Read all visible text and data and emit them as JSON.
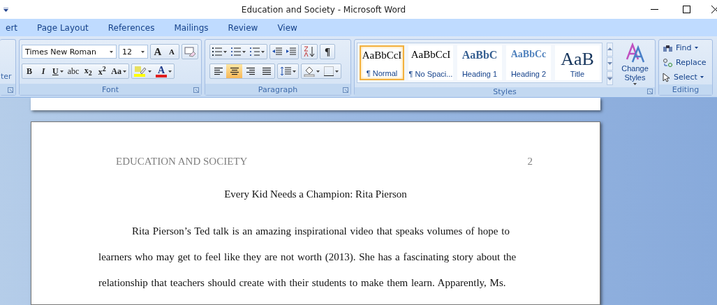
{
  "window": {
    "title": "Education and Society - Microsoft Word"
  },
  "tabs": [
    {
      "label": "ert",
      "selected": false
    },
    {
      "label": "Page Layout",
      "selected": false
    },
    {
      "label": "References",
      "selected": false
    },
    {
      "label": "Mailings",
      "selected": false
    },
    {
      "label": "Review",
      "selected": false
    },
    {
      "label": "View",
      "selected": false
    }
  ],
  "clipboard": {
    "label": "ter"
  },
  "font_group": {
    "label": "Font",
    "font_name": "Times New Roman",
    "font_size": "12",
    "size_buttons": [
      "A",
      "A"
    ],
    "format_buttons": [
      "B",
      "I",
      "U",
      "abc",
      "x$_{2}$",
      "x$^{2}$",
      "Aa"
    ],
    "font_color": {
      "text": "A",
      "color": "#e02020"
    }
  },
  "paragraph_group": {
    "label": "Paragraph",
    "pilcrow": "¶",
    "alignment": [
      {
        "kind": "left",
        "selected": false
      },
      {
        "kind": "center",
        "selected": true
      },
      {
        "kind": "right",
        "selected": false
      },
      {
        "kind": "justify",
        "selected": false
      }
    ]
  },
  "styles_group": {
    "label": "Styles",
    "change_styles": "Change Styles",
    "styles": [
      {
        "kind": "normal",
        "sample": "AaBbCcI",
        "name": "¶ Normal",
        "selected": true
      },
      {
        "kind": "normal",
        "sample": "AaBbCcI",
        "name": "¶ No Spaci...",
        "selected": false
      },
      {
        "kind": "heading1",
        "sample": "AaBbC",
        "name": "Heading 1",
        "selected": false
      },
      {
        "kind": "heading2",
        "sample": "AaBbCc",
        "name": "Heading 2",
        "selected": false
      },
      {
        "kind": "title",
        "sample": "AaB",
        "name": "Title",
        "selected": false
      }
    ]
  },
  "editing_group": {
    "label": "Editing",
    "items": [
      {
        "kind": "find",
        "label": "Find"
      },
      {
        "kind": "replace",
        "label": "Replace"
      },
      {
        "kind": "select",
        "label": "Select"
      }
    ]
  },
  "document": {
    "header": "EDUCATION AND SOCIETY",
    "page_number": "2",
    "title": "Every Kid Needs a Champion: Rita Pierson",
    "paragraph": "Rita Pierson’s Ted talk is an amazing inspirational video that speaks volumes of hope to learners who may get to feel like they are not worth (2013). She has a fascinating story about the relationship that teachers should create with their students to make them learn. Apparently, Ms."
  }
}
